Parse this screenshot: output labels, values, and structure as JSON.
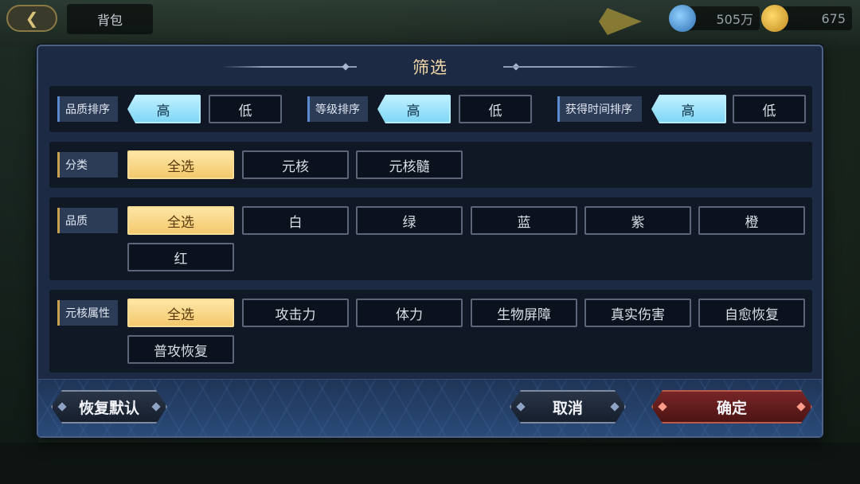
{
  "background": {
    "bag_title": "背包",
    "back_icon": "back-arrow-icon",
    "resources": [
      {
        "icon": "blue-gem-icon",
        "value": "505万"
      },
      {
        "icon": "gold-coin-icon",
        "value": "675"
      }
    ]
  },
  "modal": {
    "title": "筛选",
    "sort": {
      "groups": [
        {
          "label": "品质排序",
          "options": [
            "高",
            "低"
          ],
          "selected": "高"
        },
        {
          "label": "等级排序",
          "options": [
            "高",
            "低"
          ],
          "selected": "高"
        },
        {
          "label": "获得时间排序",
          "options": [
            "高",
            "低"
          ],
          "selected": "高"
        }
      ]
    },
    "category": {
      "label": "分类",
      "options": [
        "全选",
        "元核",
        "元核髓"
      ],
      "selected": "全选"
    },
    "quality": {
      "label": "品质",
      "options": [
        "全选",
        "白",
        "绿",
        "蓝",
        "紫",
        "橙",
        "红"
      ],
      "selected": "全选"
    },
    "attribute": {
      "label": "元核属性",
      "options": [
        "全选",
        "攻击力",
        "体力",
        "生物屏障",
        "真实伤害",
        "自愈恢复",
        "普攻恢复"
      ],
      "selected": "全选"
    },
    "footer": {
      "reset": "恢复默认",
      "cancel": "取消",
      "confirm": "确定"
    }
  },
  "colors": {
    "selected_gold": "#f4c96d",
    "selected_blue": "#7fd6f6",
    "confirm_red": "#7a2626",
    "panel_bg": "#1d2a44"
  }
}
